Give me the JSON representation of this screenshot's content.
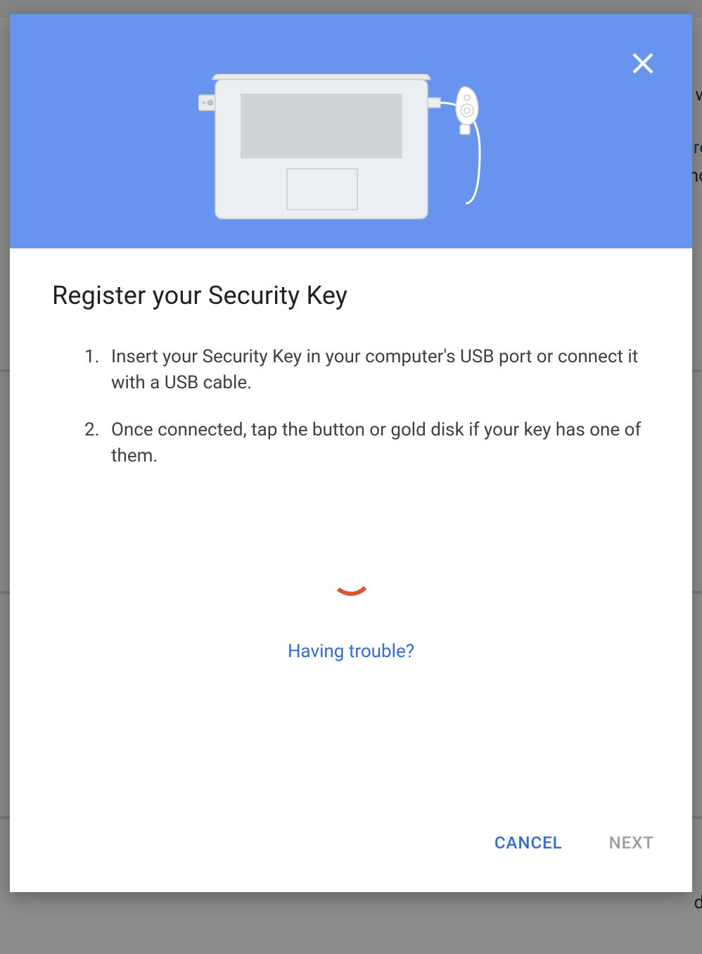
{
  "dialog": {
    "title": "Register your Security Key",
    "steps": [
      {
        "num": "1.",
        "text": "Insert your Security Key in your computer's USB port or connect it with a USB cable."
      },
      {
        "num": "2.",
        "text": "Once connected, tap the button or gold disk if your key has one of them."
      }
    ],
    "help_link": "Having trouble?",
    "buttons": {
      "cancel": "CANCEL",
      "next": "NEXT"
    },
    "icons": {
      "close": "close-icon",
      "illustration": "laptop-security-key-illustration",
      "spinner": "loading-spinner"
    }
  },
  "colors": {
    "hero_bg": "#6694ef",
    "accent_link": "#2f6bdd",
    "spinner": "#d75437",
    "next_disabled": "#9e9e9e"
  },
  "background_peek": {
    "fragments": [
      "w",
      "re",
      "ho",
      "d."
    ]
  }
}
